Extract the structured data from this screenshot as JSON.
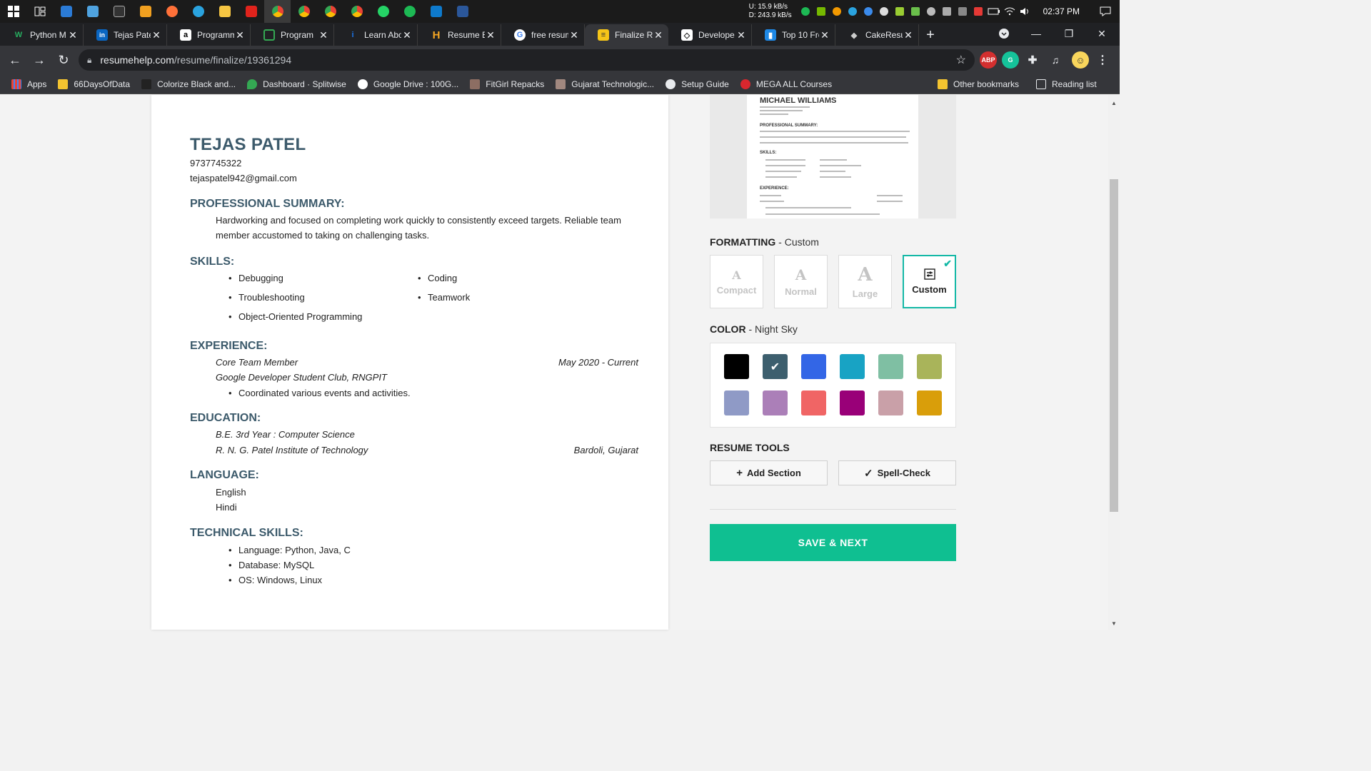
{
  "taskbar": {
    "net_up": "U:  15.9 kB/s",
    "net_down": "D: 243.9 kB/s",
    "time": "02:37 PM"
  },
  "tabs": [
    {
      "title": "Python M",
      "fav_color": "#27ae60",
      "fav_letter": "W"
    },
    {
      "title": "Tejas Pate",
      "fav_color": "#0a66c2",
      "fav_letter": "in"
    },
    {
      "title": "Programm",
      "fav_color": "#000000",
      "fav_letter": "a"
    },
    {
      "title": "Program",
      "fav_color": "#202124",
      "fav_letter": "▯"
    },
    {
      "title": "Learn Abo",
      "fav_color": "#1a73e8",
      "fav_letter": "i"
    },
    {
      "title": "Resume B",
      "fav_color": "#f5a623",
      "fav_letter": "H"
    },
    {
      "title": "free resum",
      "fav_color": "#ffffff",
      "fav_letter": "G"
    },
    {
      "title": "Finalize Re",
      "fav_color": "#f5c518",
      "fav_letter": "≡"
    },
    {
      "title": "Develope",
      "fav_color": "#ffffff",
      "fav_letter": "◇"
    },
    {
      "title": "Top 10 Fre",
      "fav_color": "#1e88e5",
      "fav_letter": "▮"
    },
    {
      "title": "CakeResu",
      "fav_color": "#555555",
      "fav_letter": "◆"
    }
  ],
  "address": {
    "host": "resumehelp.com",
    "path": "/resume/finalize/19361294"
  },
  "bookmarks": [
    {
      "label": "Apps",
      "color": "#4285f4"
    },
    {
      "label": "66DaysOfData",
      "color": "#f4c430"
    },
    {
      "label": "Colorize Black and...",
      "color": "#222222"
    },
    {
      "label": "Dashboard · Splitwise",
      "color": "#34a853"
    },
    {
      "label": "Google Drive : 100G...",
      "color": "#ffffff"
    },
    {
      "label": "FitGirl Repacks",
      "color": "#8d6e63"
    },
    {
      "label": "Gujarat Technologic...",
      "color": "#a1887f"
    },
    {
      "label": "Setup Guide",
      "color": "#e8eaed"
    },
    {
      "label": "MEGA ALL Courses",
      "color": "#d9272e"
    }
  ],
  "bookmarks_right": {
    "other": "Other bookmarks",
    "reading": "Reading list"
  },
  "resume": {
    "name": "TEJAS PATEL",
    "phone": "9737745322",
    "email": "tejaspatel942@gmail.com",
    "summary_head": "PROFESSIONAL SUMMARY:",
    "summary_line1": "Hardworking and focused on completing work quickly to consistently exceed targets. Reliable team",
    "summary_line2": "member accustomed to taking on challenging tasks.",
    "skills_head": "SKILLS:",
    "skills_left": [
      "Debugging",
      "Troubleshooting",
      "Object-Oriented Programming"
    ],
    "skills_right": [
      "Coding",
      "Teamwork"
    ],
    "exp_head": "EXPERIENCE:",
    "exp_title": "Core Team Member",
    "exp_dates": "May 2020 - Current",
    "exp_org": "Google Developer Student Club, RNGPIT",
    "exp_bullet": "Coordinated various events and activities.",
    "edu_head": "EDUCATION:",
    "edu_degree": "B.E. 3rd Year : Computer Science",
    "edu_school": "R. N. G. Patel Institute of Technology",
    "edu_place": "Bardoli, Gujarat",
    "lang_head": "LANGUAGE:",
    "languages": [
      "English",
      "Hindi"
    ],
    "tech_head": "TECHNICAL SKILLS:",
    "tech": [
      "Language: Python, Java, C",
      "Database: MySQL",
      "OS: Windows, Linux"
    ]
  },
  "preview": {
    "name": "MICHAEL WILLIAMS",
    "h1": "PROFESSIONAL SUMMARY:",
    "h2": "SKILLS:",
    "h3": "EXPERIENCE:"
  },
  "formatting": {
    "label": "FORMATTING",
    "value": "- Custom",
    "options": [
      "Compact",
      "Normal",
      "Large",
      "Custom"
    ]
  },
  "color": {
    "label": "COLOR",
    "value": "- Night Sky",
    "swatches": [
      "#000000",
      "#3d5f6e",
      "#3366e6",
      "#18a3c4",
      "#7fbfa3",
      "#a9b45a",
      "#8f9ac6",
      "#ab7fb8",
      "#f06565",
      "#990078",
      "#c9a0a8",
      "#d99e0a"
    ]
  },
  "tools": {
    "label": "RESUME TOOLS",
    "add_section": "Add Section",
    "spell_check": "Spell-Check"
  },
  "save_label": "SAVE & NEXT"
}
